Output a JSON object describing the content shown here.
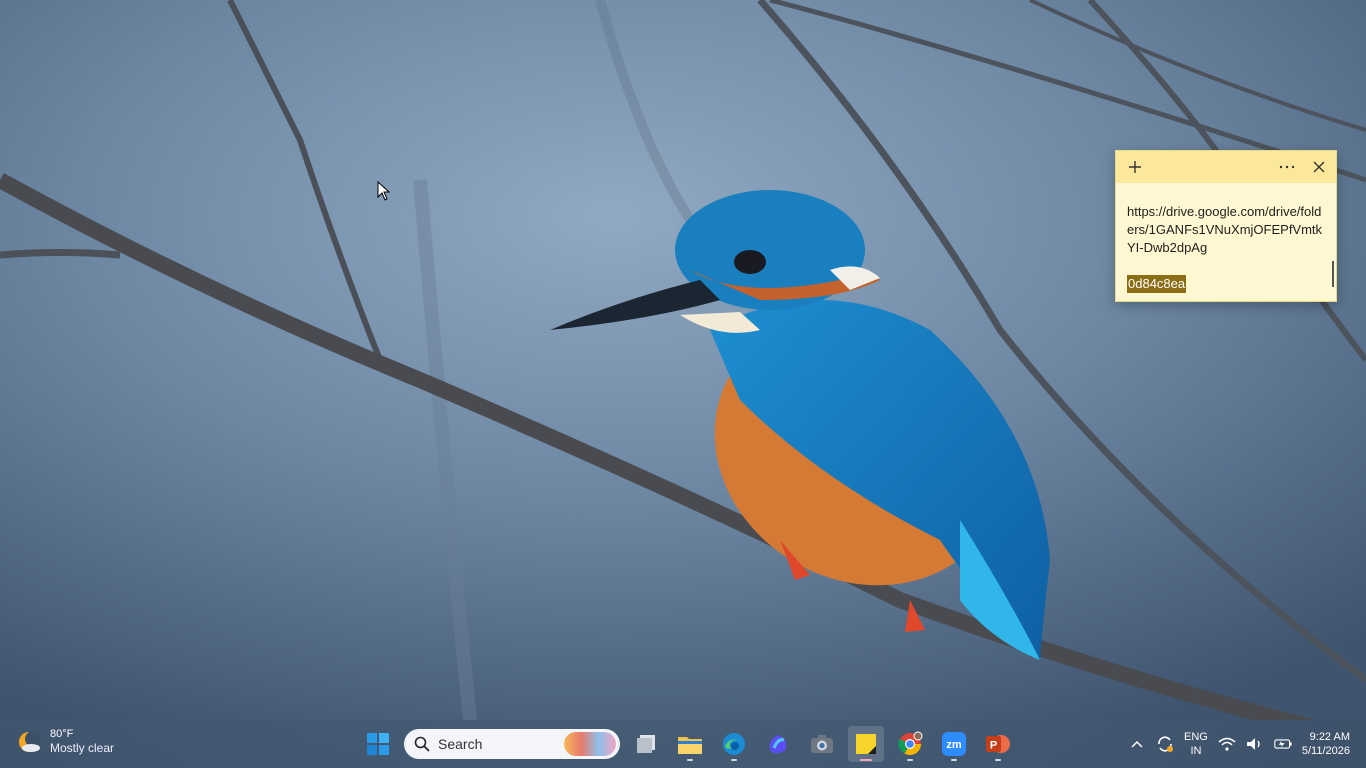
{
  "sticky_note": {
    "new_note_icon": "plus-icon",
    "menu_icon": "ellipsis-icon",
    "close_icon": "close-icon",
    "link_text": "https://drive.google.com/drive/folders/1GANFs1VNuXmjOFEPfVmtkYI-Dwb2dpAg",
    "highlighted_text": "0d84c8ea"
  },
  "taskbar": {
    "weather": {
      "temperature": "80°F",
      "condition": "Mostly clear",
      "icon": "moon-cloud-icon"
    },
    "search": {
      "placeholder": "Search"
    },
    "apps": [
      {
        "name": "start",
        "icon": "windows-logo-icon"
      },
      {
        "name": "task-view",
        "icon": "task-view-icon"
      },
      {
        "name": "file-explorer",
        "icon": "folder-icon"
      },
      {
        "name": "edge",
        "icon": "edge-icon"
      },
      {
        "name": "copilot",
        "icon": "copilot-icon"
      },
      {
        "name": "camera",
        "icon": "camera-icon"
      },
      {
        "name": "sticky-notes",
        "icon": "sticky-notes-icon"
      },
      {
        "name": "chrome",
        "icon": "chrome-icon"
      },
      {
        "name": "zoom",
        "icon": "zoom-icon",
        "label": "zm"
      },
      {
        "name": "powerpoint",
        "icon": "powerpoint-icon",
        "label": "P"
      }
    ],
    "tray": {
      "language_line1": "ENG",
      "language_line2": "IN",
      "time": "9:22 AM",
      "date": "5/11/2026"
    }
  },
  "colors": {
    "note_header": "#fbe89b",
    "note_body": "#fff7d1",
    "highlight": "#8a6d14"
  }
}
